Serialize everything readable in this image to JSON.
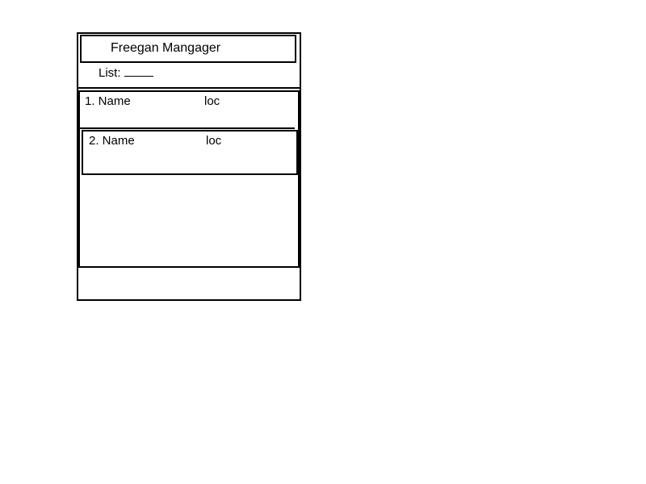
{
  "app": {
    "title": "Freegan Mangager"
  },
  "list_field": {
    "label": "List:"
  },
  "items": [
    {
      "name": "1. Name",
      "loc": "loc"
    },
    {
      "name": "2. Name",
      "loc": "loc"
    }
  ]
}
